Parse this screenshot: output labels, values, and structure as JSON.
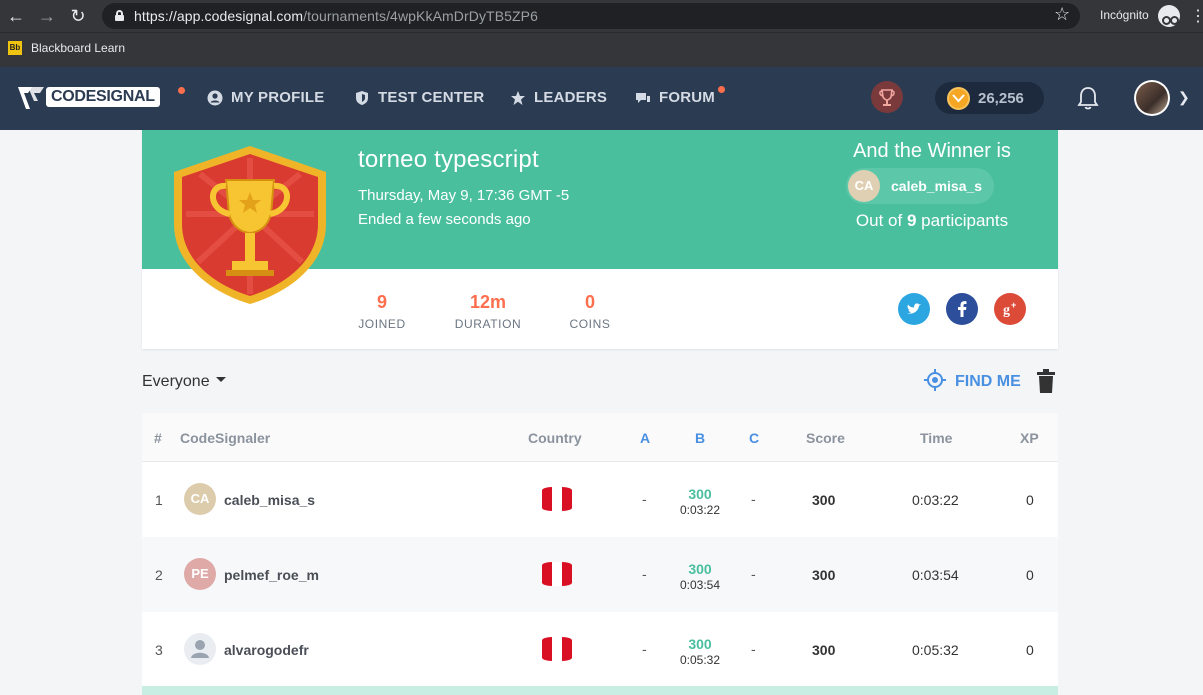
{
  "browser": {
    "url_host": "https://app.codesignal.com",
    "url_path": "/tournaments/4wpKkAmDrDyTB5ZP6",
    "mode_label": "Incógnito",
    "bookmark": "Blackboard Learn",
    "bookmark_icon_text": "Bb"
  },
  "header": {
    "logo_text": "CODESIGNAL",
    "nav": [
      {
        "label": "MY PROFILE",
        "icon": "user-circle-icon"
      },
      {
        "label": "TEST CENTER",
        "icon": "shield-icon"
      },
      {
        "label": "LEADERS",
        "icon": "star-icon"
      },
      {
        "label": "FORUM",
        "icon": "chat-icon"
      }
    ],
    "coins": "26,256",
    "accent_color": "#ff6f4e",
    "bg_color": "#2b3b52"
  },
  "tournament": {
    "title": "torneo typescript",
    "date": "Thursday, May 9, 17:36 GMT -5",
    "status": "Ended a few seconds ago",
    "winner_heading": "And the Winner is",
    "winner_initials": "CA",
    "winner_name": "caleb_misa_s",
    "participants_prefix": "Out of",
    "participants_count": "9",
    "participants_suffix": "participants",
    "stats": [
      {
        "value": "9",
        "label": "JOINED"
      },
      {
        "value": "12m",
        "label": "DURATION"
      },
      {
        "value": "0",
        "label": "COINS"
      }
    ],
    "banner_color": "#49bf9e"
  },
  "filters": {
    "audience": "Everyone",
    "find_me": "FIND ME"
  },
  "table": {
    "headers": {
      "rank": "#",
      "user": "CodeSignaler",
      "country": "Country",
      "a": "A",
      "b": "B",
      "c": "C",
      "score": "Score",
      "time": "Time",
      "xp": "XP"
    },
    "rows": [
      {
        "rank": "1",
        "initials": "CA",
        "avatar_color": "#dcccac",
        "name": "caleb_misa_s",
        "a": "-",
        "b_points": "300",
        "b_time": "0:03:22",
        "c": "-",
        "score": "300",
        "time": "0:03:22",
        "xp": "0"
      },
      {
        "rank": "2",
        "initials": "PE",
        "avatar_color": "#dea9a7",
        "name": "pelmef_roe_m",
        "a": "-",
        "b_points": "300",
        "b_time": "0:03:54",
        "c": "-",
        "score": "300",
        "time": "0:03:54",
        "xp": "0"
      },
      {
        "rank": "3",
        "initials": "",
        "avatar_color": "#e9ecf1",
        "name": "alvarogodefr",
        "a": "-",
        "b_points": "300",
        "b_time": "0:05:32",
        "c": "-",
        "score": "300",
        "time": "0:05:32",
        "xp": "0"
      }
    ]
  }
}
